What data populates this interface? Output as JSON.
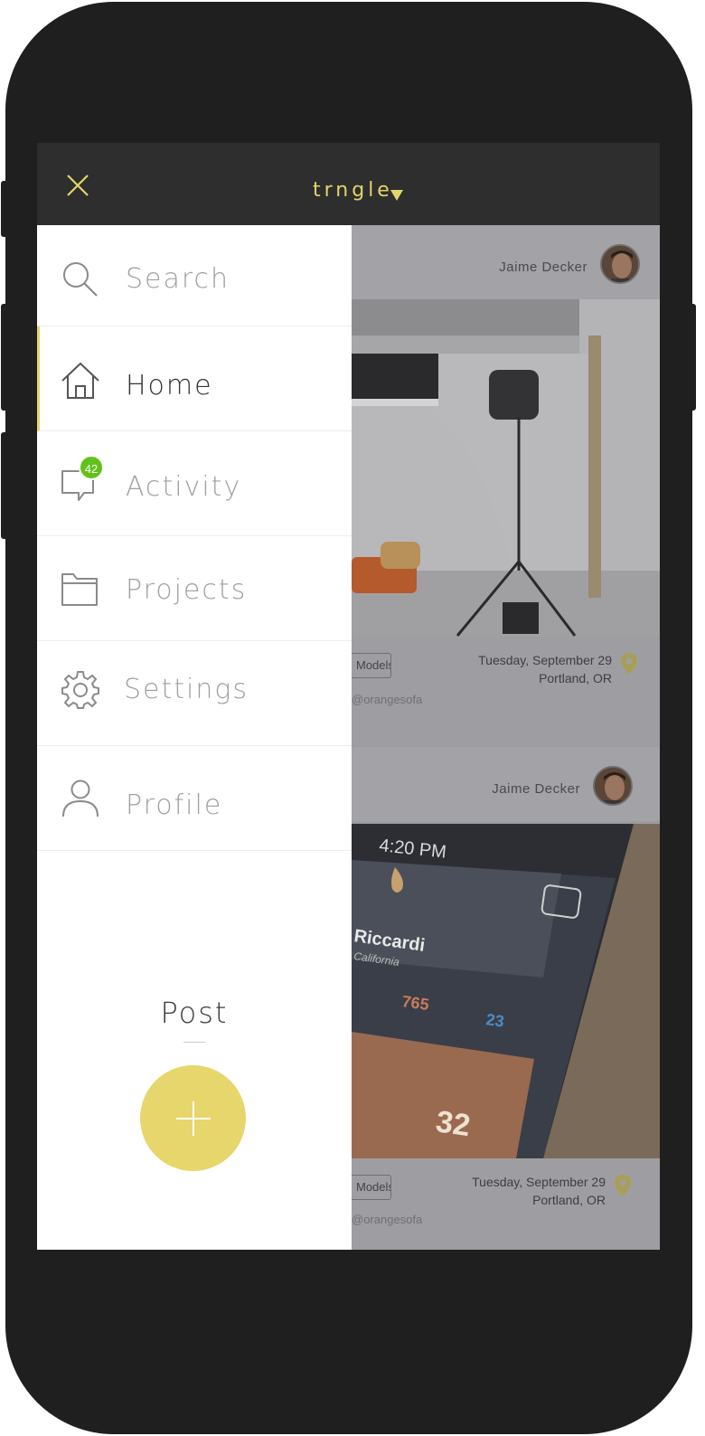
{
  "header": {
    "title": "trngle",
    "title_caret": "▾"
  },
  "menu": {
    "items": [
      {
        "label": "Search",
        "icon": "search-icon",
        "active": false
      },
      {
        "label": "Home",
        "icon": "home-icon",
        "active": true
      },
      {
        "label": "Activity",
        "icon": "chat-bubble-icon",
        "active": false,
        "badge": "42"
      },
      {
        "label": "Projects",
        "icon": "folder-icon",
        "active": false
      },
      {
        "label": "Settings",
        "icon": "gear-icon",
        "active": false
      },
      {
        "label": "Profile",
        "icon": "user-icon",
        "active": false
      }
    ],
    "post_label": "Post"
  },
  "feed": {
    "cards": [
      {
        "author": "Jaime Decker",
        "tag": "Models",
        "date": "Tuesday, September 29",
        "location": "Portland, OR",
        "user": "@orangesofa"
      },
      {
        "author": "Jaime Decker",
        "tag": "Models",
        "date": "Tuesday, September 29",
        "location": "Portland, OR",
        "user": "@orangesofa",
        "phone_time": "4:20 PM",
        "phone_name": "Riccardi",
        "phone_place": "California",
        "phone_photos": "765",
        "phone_audio": "23",
        "phone_big": "32"
      }
    ]
  },
  "colors": {
    "accent": "#e6d66b",
    "badge": "#62c21b",
    "topbar": "#2e2e2e",
    "frame": "#1f1f1f"
  }
}
